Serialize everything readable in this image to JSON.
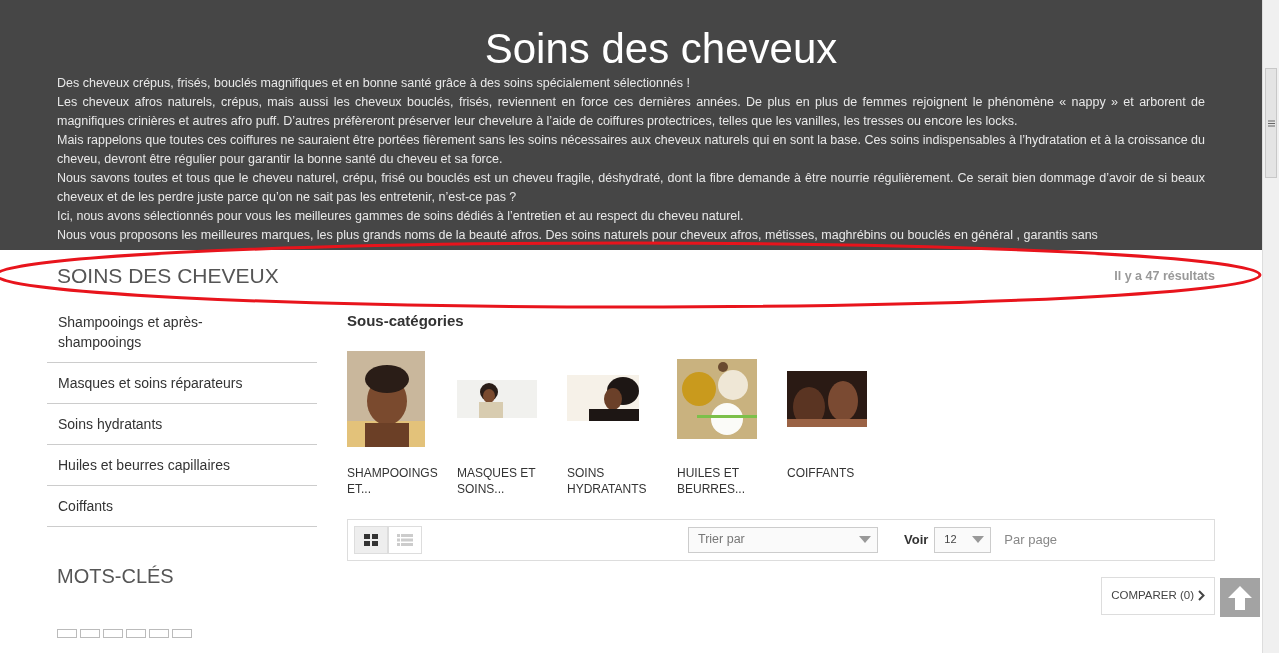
{
  "header": {
    "title": "Soins des cheveux",
    "paragraphs": [
      "Des cheveux crépus, frisés, bouclés magnifiques et en bonne santé grâce à des soins spécialement sélectionnés !",
      "Les cheveux afros naturels, crépus, mais aussi les cheveux bouclés, frisés, reviennent en force ces dernières années. De plus en plus de femmes rejoignent le phénomène « nappy » et arborent de magnifiques crinières et autres afro puff. D’autres préfèreront préserver leur chevelure à l’aide de coiffures protectrices, telles que les vanilles, les tresses ou encore les locks.",
      "Mais rappelons que toutes ces coiffures ne sauraient être portées fièrement sans les soins nécessaires aux cheveux naturels qui en sont la base. Ces soins indispensables à l’hydratation et à la croissance du cheveu, devront être régulier pour garantir la bonne santé du cheveu et sa force.",
      "Nous savons toutes et tous que le cheveu naturel, crépu, frisé ou bouclés est un cheveu fragile, déshydraté, dont la fibre demande à être nourrie régulièrement. Ce serait bien dommage d’avoir de si beaux cheveux et de les perdre juste parce qu’on ne sait pas les entretenir, n’est-ce pas ?",
      "Ici, nous avons sélectionnés pour vous les meilleures gammes de soins dédiés à l’entretien et au respect du cheveu naturel.",
      "Nous vous proposons les meilleures marques, les plus grands noms de la beauté afros.  Des soins naturels pour cheveux afros, métisses, maghrébins ou bouclés en général , garantis sans"
    ]
  },
  "category_heading": "SOINS DES CHEVEUX",
  "results_count": "Il y a 47 résultats",
  "sidebar": {
    "items": [
      "Shampooings et après-shampooings",
      "Masques et soins réparateurs",
      "Soins hydratants",
      "Huiles et beurres capillaires",
      "Coiffants"
    ]
  },
  "keywords": {
    "title": "MOTS-CLÉS"
  },
  "subcategories": {
    "title": "Sous-catégories",
    "items": [
      {
        "label": "SHAMPOOINGS ET...",
        "kind": "picture"
      },
      {
        "label": "MASQUES ET SOINS...",
        "kind": "picture"
      },
      {
        "label": "SOINS HYDRATANTS",
        "kind": "picture"
      },
      {
        "label": "HUILES ET BEURRES...",
        "kind": "picture"
      },
      {
        "label": "COIFFANTS",
        "kind": "picture"
      }
    ]
  },
  "toolbar": {
    "views": [
      {
        "kind": "grid",
        "selected": true
      },
      {
        "kind": "list",
        "selected": false
      }
    ],
    "sort": {
      "placeholder": "Trier par"
    },
    "show_label": "Voir",
    "per_page": "12",
    "per_page_label": "Par page"
  },
  "compare_button": "COMPARER (0)"
}
